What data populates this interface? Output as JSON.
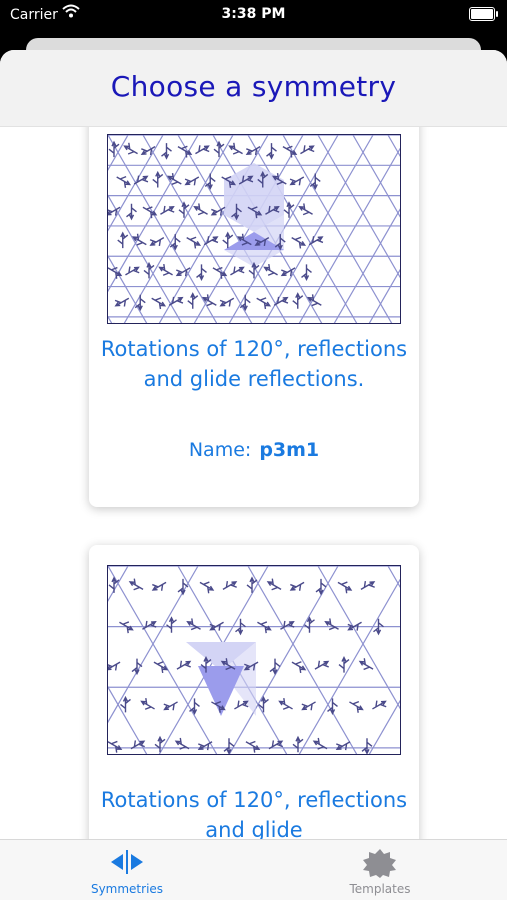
{
  "status": {
    "carrier": "Carrier",
    "time": "3:38 PM"
  },
  "header": {
    "title": "Choose a symmetry"
  },
  "cards": [
    {
      "description": "Rotations of 120°, reflections and glide reflections.",
      "name_label": "Name:",
      "name": "p3m1"
    },
    {
      "description": "Rotations of 120°, reflections and glide"
    }
  ],
  "tabs": [
    {
      "label": "Symmetries",
      "icon": "symmetry-icon",
      "selected": true
    },
    {
      "label": "Templates",
      "icon": "gear-badge-icon",
      "selected": false
    }
  ],
  "colors": {
    "title": "#1a18b8",
    "accent": "#1a7ae0",
    "pattern_line": "#8d91d0",
    "pattern_glyph": "#4a4a8a",
    "highlight_light": "#d3d4f5",
    "highlight_dark": "#9b9cec"
  }
}
